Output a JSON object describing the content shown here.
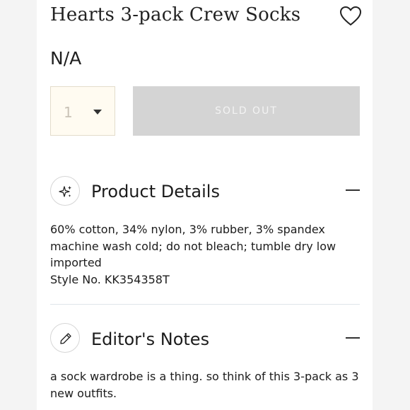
{
  "product": {
    "title": "Hearts 3-pack Crew Socks",
    "price": "N/A"
  },
  "purchase": {
    "quantity": "1",
    "button_label": "SOLD OUT"
  },
  "sections": [
    {
      "title": "Product Details",
      "icon": "sparkle-icon",
      "lines": [
        "60% cotton, 34% nylon, 3% rubber, 3% spandex",
        "machine wash cold; do not bleach; tumble dry low",
        "imported",
        "Style No. KK354358T"
      ]
    },
    {
      "title": "Editor's Notes",
      "icon": "pencil-icon",
      "lines": [
        "a sock wardrobe is a thing. so think of this 3-pack as 3",
        "new outfits."
      ]
    }
  ],
  "colors": {
    "sold_out_bg": "#d4d4d4",
    "qty_bg": "#fffbf1"
  }
}
